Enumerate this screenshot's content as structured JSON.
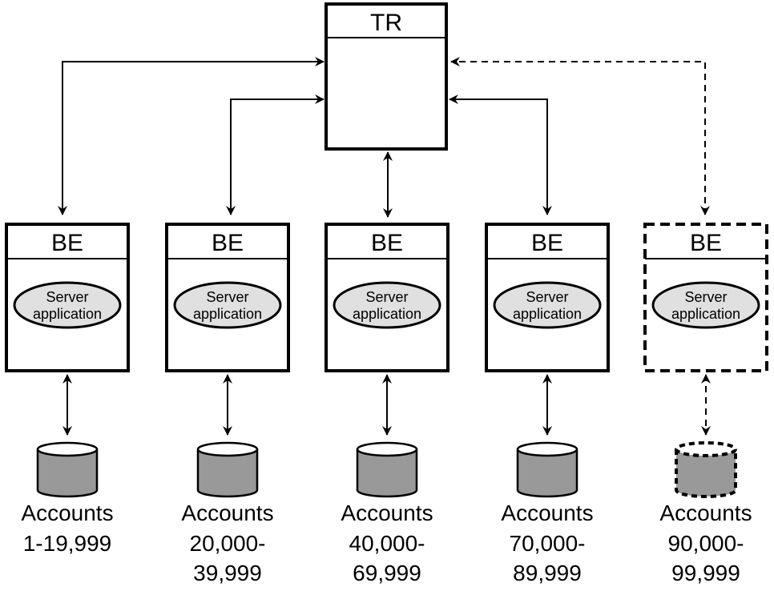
{
  "tr": {
    "label": "TR"
  },
  "backends": [
    {
      "label": "BE",
      "app_line1": "Server",
      "app_line2": "application",
      "accounts_label": "Accounts",
      "range_line1": "1-19,999",
      "range_line2": "",
      "planned": false
    },
    {
      "label": "BE",
      "app_line1": "Server",
      "app_line2": "application",
      "accounts_label": "Accounts",
      "range_line1": "20,000-",
      "range_line2": "39,999",
      "planned": false
    },
    {
      "label": "BE",
      "app_line1": "Server",
      "app_line2": "application",
      "accounts_label": "Accounts",
      "range_line1": "40,000-",
      "range_line2": "69,999",
      "planned": false
    },
    {
      "label": "BE",
      "app_line1": "Server",
      "app_line2": "application",
      "accounts_label": "Accounts",
      "range_line1": "70,000-",
      "range_line2": "89,999",
      "planned": false
    },
    {
      "label": "BE",
      "app_line1": "Server",
      "app_line2": "application",
      "accounts_label": "Accounts",
      "range_line1": "90,000-",
      "range_line2": "99,999",
      "planned": true
    }
  ],
  "colors": {
    "ellipse_fill": "#e0e0e0",
    "cylinder_fill": "#999999",
    "stroke": "#000000"
  }
}
